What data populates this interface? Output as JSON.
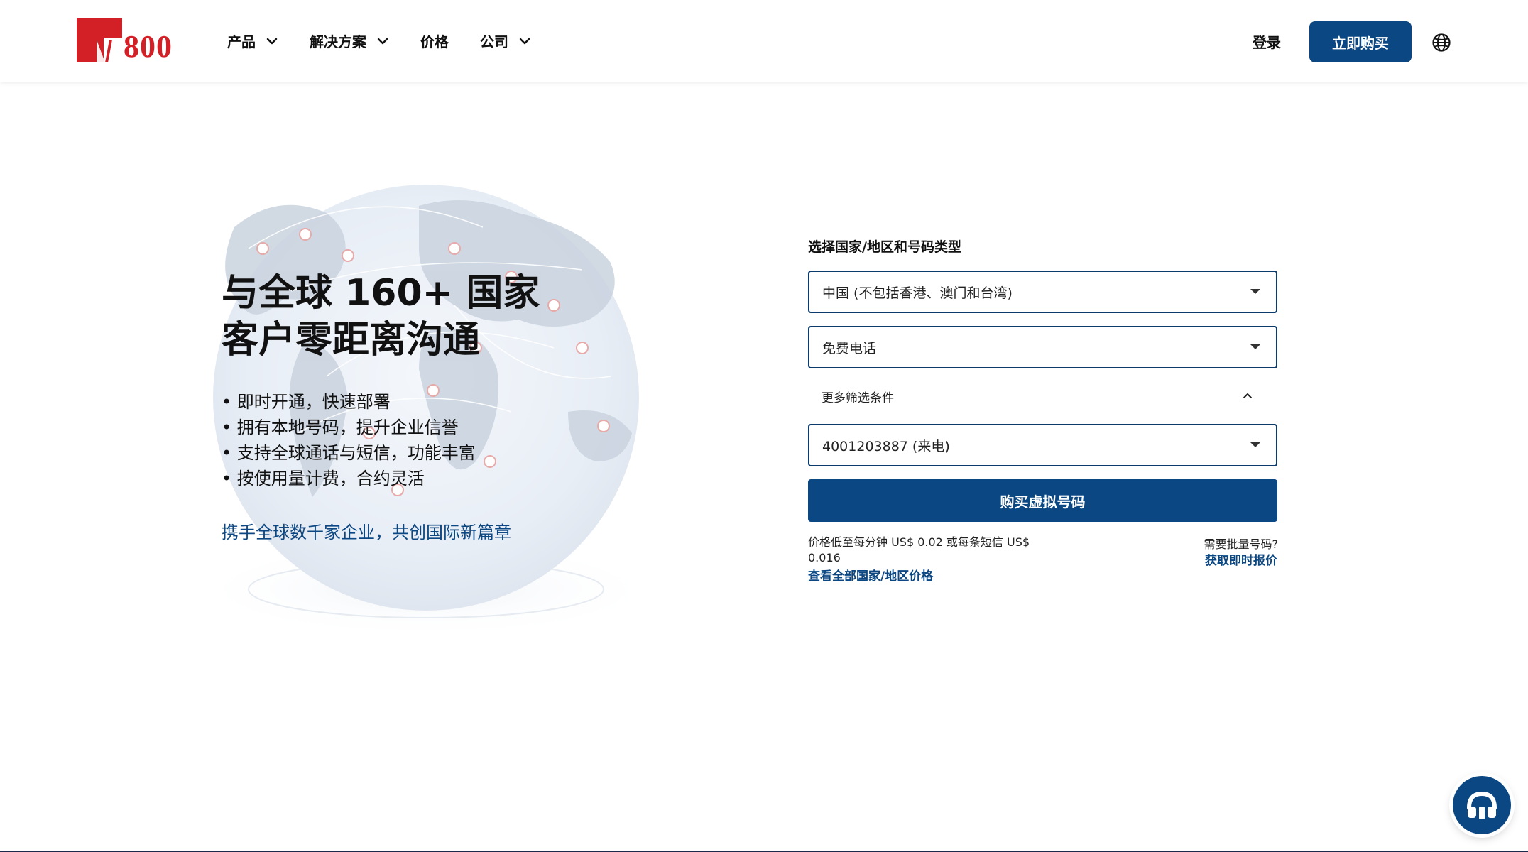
{
  "brand": {
    "logo_text": "800",
    "logo_letter": "M",
    "color": "#d32027"
  },
  "nav": {
    "items": [
      {
        "label": "产品",
        "has_dropdown": true
      },
      {
        "label": "解决方案",
        "has_dropdown": true
      },
      {
        "label": "价格",
        "has_dropdown": false
      },
      {
        "label": "公司",
        "has_dropdown": true
      }
    ],
    "login_label": "登录",
    "buy_label": "立即购买",
    "language_icon": "globe-icon"
  },
  "hero": {
    "title_line1": "与全球 160+ 国家",
    "title_line2": "客户零距离沟通",
    "bullets": [
      "即时开通，快速部署",
      "拥有本地号码，提升企业信誉",
      "支持全球通话与短信，功能丰富",
      "按使用量计费，合约灵活"
    ],
    "tagline": "携手全球数千家企业，共创国际新篇章"
  },
  "form": {
    "label": "选择国家/地区和号码类型",
    "country_value": "中国 (不包括香港、澳门和台湾)",
    "type_value": "免费电话",
    "more_filters_label": "更多筛选条件",
    "number_value": "4001203887 (来电)",
    "buy_button_label": "购买虚拟号码",
    "price_note": "价格低至每分钟 US$ 0.02 或每条短信 US$ 0.016",
    "price_link": "查看全部国家/地区价格",
    "bulk_question": "需要批量号码?",
    "bulk_link": "获取即时报价"
  },
  "support": {
    "icon": "headset-icon"
  },
  "colors": {
    "primary": "#0b4782",
    "brand_red": "#d32027"
  }
}
